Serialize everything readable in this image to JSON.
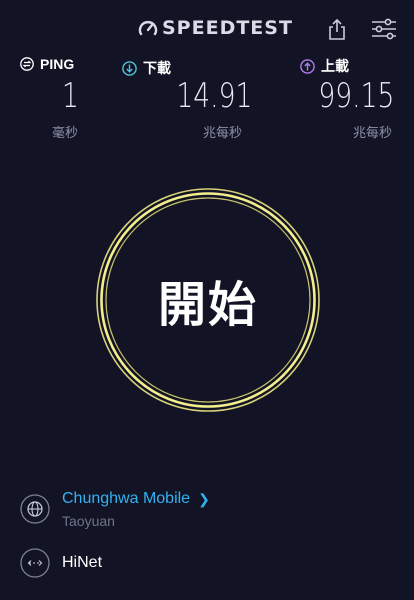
{
  "header": {
    "logo_text": "SPEEDTEST",
    "icons": [
      "speedometer-icon",
      "share-icon",
      "settings-sliders-icon"
    ]
  },
  "metrics": {
    "ping": {
      "label": "PING",
      "value": "1",
      "unit": "毫秒",
      "icon": "ping-icon",
      "color": "#ffffff"
    },
    "download": {
      "label": "下載",
      "value": "14.91",
      "unit": "兆每秒",
      "icon": "download-arrow-icon",
      "color": "#4ec6d9"
    },
    "upload": {
      "label": "上載",
      "value": "99.15",
      "unit": "兆每秒",
      "icon": "upload-arrow-icon",
      "color": "#b07cf0"
    }
  },
  "start_button": {
    "label": "開始",
    "ring_color": "#f4ee8c"
  },
  "provider": {
    "isp_name": "Chunghwa Mobile",
    "isp_location": "Taoyuan",
    "isp_color": "#32b2f0",
    "server_name": "HiNet"
  }
}
